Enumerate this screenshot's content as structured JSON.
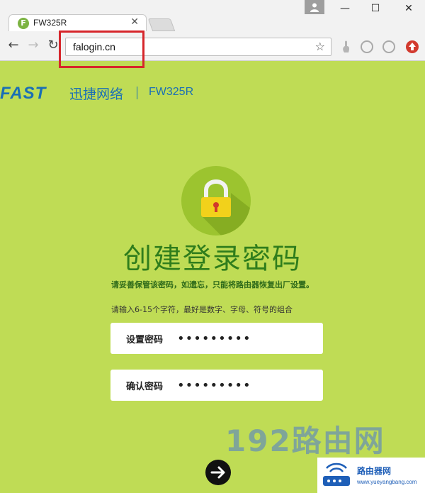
{
  "browser": {
    "tab_title": "FW325R",
    "tab_favicon": "F",
    "url": "falogin.cn",
    "icons": [
      "back-icon",
      "forward-icon",
      "reload-icon",
      "star-icon",
      "profile-icon",
      "minimize-icon",
      "maximize-icon",
      "close-icon"
    ]
  },
  "brand": {
    "logo": "FAST",
    "name_cn": "迅捷网络",
    "model": "FW325R",
    "color": "#1a6fb5"
  },
  "page": {
    "title": "创建登录密码",
    "warning": "请妥善保管该密码，如遗忘，只能将路由器恢复出厂设置。",
    "hint": "请输入6-15个字符，最好是数字、字母、符号的组合",
    "set_password_label": "设置密码",
    "set_password_value": "•••••••••",
    "confirm_password_label": "确认密码",
    "confirm_password_value": "•••••••••",
    "accent": "#2f7d1c",
    "background": "#bfdc55"
  },
  "watermark": {
    "text": "192路由网",
    "badge_cn": "路由器网",
    "badge_url": "www.yueyangbang.com"
  }
}
